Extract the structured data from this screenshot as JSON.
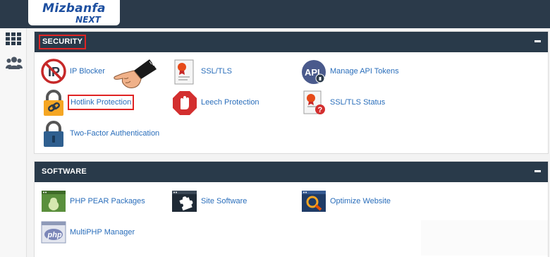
{
  "logo": {
    "name": "Mizbanfa",
    "tagline": "NEXT"
  },
  "sidebar": {
    "items": [
      {
        "icon": "grid-icon"
      },
      {
        "icon": "users-icon"
      }
    ]
  },
  "security": {
    "title": "SECURITY",
    "items": [
      {
        "label": "IP Blocker",
        "icon": "ip-blocker-icon"
      },
      {
        "label": "SSL/TLS",
        "icon": "ssl-certificate-icon"
      },
      {
        "label": "Manage API Tokens",
        "icon": "api-tokens-icon"
      },
      {
        "label": "Hotlink Protection",
        "icon": "lock-link-icon"
      },
      {
        "label": "Leech Protection",
        "icon": "stop-hand-icon"
      },
      {
        "label": "SSL/TLS Status",
        "icon": "ssl-status-icon"
      },
      {
        "label": "Two-Factor Authentication",
        "icon": "lock-icon"
      }
    ]
  },
  "software": {
    "title": "SOFTWARE",
    "items": [
      {
        "label": "PHP PEAR Packages",
        "icon": "php-pear-icon"
      },
      {
        "label": "Site Software",
        "icon": "puzzle-icon"
      },
      {
        "label": "Optimize Website",
        "icon": "magnifier-icon"
      },
      {
        "label": "MultiPHP Manager",
        "icon": "php-icon"
      }
    ]
  },
  "colors": {
    "header": "#293a4a",
    "link": "#2a6ebb",
    "highlight": "#e02424"
  }
}
